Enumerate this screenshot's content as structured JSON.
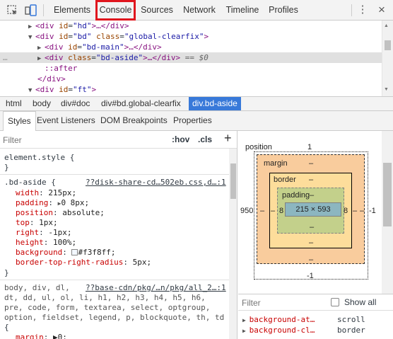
{
  "toolbar": {
    "tabs": [
      "Elements",
      "Console",
      "Sources",
      "Network",
      "Timeline",
      "Profiles"
    ],
    "selected_tab": "Console",
    "highlight_color": "#e0161e",
    "more_icon": "⋮",
    "close_icon": "×"
  },
  "dom": {
    "lines": [
      {
        "tag_open": "<div",
        "id_attr": "id",
        "id_val": "\"hd\"",
        "rest": ">…</div>"
      },
      {
        "tag_open": "<div",
        "id_attr": "id",
        "id_val": "\"bd\"",
        "cls_attr": "class",
        "cls_val": "\"global-clearfix\"",
        "rest": ">"
      },
      {
        "tag_open": "<div",
        "id_attr": "id",
        "id_val": "\"bd-main\"",
        "rest": ">…</div>"
      },
      {
        "tag_open": "<div",
        "cls_attr": "class",
        "cls_val": "\"bd-aside\"",
        "rest": ">…</div>",
        "eq": " == $0",
        "dots": "…"
      },
      {
        "pseudo": "::after"
      },
      {
        "close": "</div>"
      },
      {
        "tag_open": "<div",
        "id_attr": "id",
        "id_val": "\"ft\"",
        "rest": ">"
      }
    ]
  },
  "breadcrumb": [
    "html",
    "body",
    "div#doc",
    "div#bd.global-clearfix",
    "div.bd-aside"
  ],
  "subtabs": [
    "Styles",
    "Event Listeners",
    "DOM Breakpoints",
    "Properties"
  ],
  "styles": {
    "filter_placeholder": "Filter",
    "hov": ":hov",
    "cls": ".cls",
    "plus": "+",
    "element_style": "element.style {",
    "brace_close": "}",
    "rule1": {
      "selector": ".bd-aside {",
      "source": "??disk-share-cd…502eb.css,d…:1",
      "props": [
        {
          "name": "width",
          "value": "215px;"
        },
        {
          "name": "padding",
          "value": "0 8px;",
          "arrow": "▶"
        },
        {
          "name": "position",
          "value": "absolute;"
        },
        {
          "name": "top",
          "value": "1px;"
        },
        {
          "name": "right",
          "value": "-1px;"
        },
        {
          "name": "height",
          "value": "100%;"
        },
        {
          "name": "background",
          "value": "#f3f8ff;",
          "swatch": "#f3f8ff"
        },
        {
          "name": "border-top-right-radius",
          "value": "5px;"
        }
      ]
    },
    "rule2": {
      "selector_lines": [
        "body, div, dl,",
        "dt, dd, ul, ol, li, h1, h2, h3, h4, h5, h6,",
        "pre, code, form, textarea, select, optgroup,",
        "option, fieldset, legend, p, blockquote, th, td",
        "{"
      ],
      "source": "??base-cdn/pkg/…n/pkg/all_2…:1",
      "first_prop": "margin",
      "first_val": "▶0;"
    }
  },
  "boxmodel": {
    "position_label": "position",
    "position_top": "1",
    "position_left": "950",
    "position_right": "-1",
    "position_bottom": "-1",
    "margin_label": "margin",
    "margin_top": "–",
    "margin_left": "–",
    "margin_right": "–",
    "margin_bottom": "–",
    "border_label": "border",
    "border_top": "–",
    "border_left": "–",
    "border_right": "–",
    "border_bottom": "–",
    "padding_label": "padding",
    "padding_top": "–",
    "padding_left": "8",
    "padding_right": "8",
    "padding_bottom": "–",
    "content_size": "215 × 593",
    "filter_placeholder": "Filter",
    "show_all": "Show all",
    "computed": [
      {
        "name": "background-at…",
        "value": "scroll"
      },
      {
        "name": "background-cl…",
        "value": "border"
      }
    ]
  }
}
